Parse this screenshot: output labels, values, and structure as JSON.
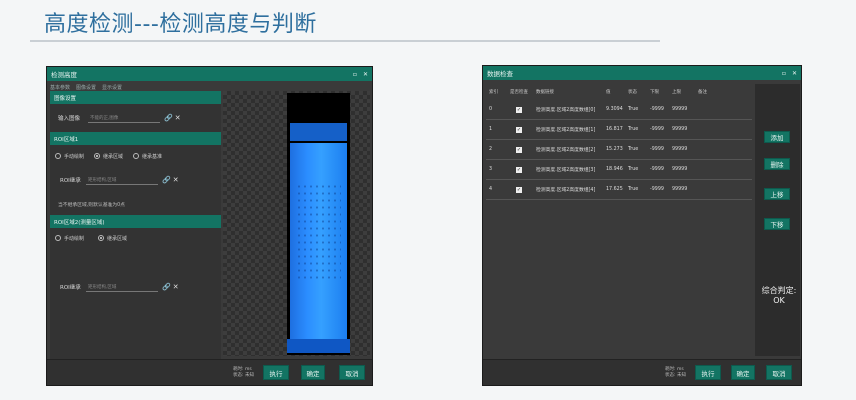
{
  "slide": {
    "title": "高度检测---检测高度与判断"
  },
  "window1": {
    "title": "检测高度",
    "tabs": [
      "基本参数",
      "图像设置",
      "显示设置"
    ],
    "section1": "图像设置",
    "input_label": "输入图像",
    "input_placeholder": "不能的正,图像",
    "section2": "ROI区域1",
    "radio1": [
      "手动绘制",
      "继承区域",
      "继承基准"
    ],
    "roi_label": "ROI继承",
    "roi_placeholder": "矩形结构,区域",
    "note": "当不继承区域,则默认基准为0点",
    "section3": "ROI区域2(测量区域)",
    "radio2": [
      "手动绘制",
      "继承区域"
    ],
    "roi2_label": "ROI继承",
    "roi2_placeholder": "矩形结构,区域",
    "status_time": "耗时: ms",
    "status_state": "状态: 未知",
    "buttons": [
      "执行",
      "确定",
      "取消"
    ]
  },
  "window2": {
    "title": "数据检查",
    "headers": [
      "索引",
      "是否检查",
      "数据链接",
      "值",
      "状态",
      "下限",
      "上限",
      "备注"
    ],
    "rows": [
      [
        "0",
        "✓",
        "检测高度.区域2高度数组[0]",
        "9.3094",
        "True",
        "-9999",
        "99999",
        ""
      ],
      [
        "1",
        "✓",
        "检测高度.区域2高度数组[1]",
        "16.817",
        "True",
        "-9999",
        "99999",
        ""
      ],
      [
        "2",
        "✓",
        "检测高度.区域2高度数组[2]",
        "15.273",
        "True",
        "-9999",
        "99999",
        ""
      ],
      [
        "3",
        "✓",
        "检测高度.区域2高度数组[3]",
        "18.946",
        "True",
        "-9999",
        "99999",
        ""
      ],
      [
        "4",
        "✓",
        "检测高度.区域2高度数组[4]",
        "17.625",
        "True",
        "-9999",
        "99999",
        ""
      ]
    ],
    "side_buttons": [
      "添加",
      "删除",
      "上移",
      "下移"
    ],
    "verdict_label": "综合判定:",
    "verdict_value": "OK",
    "status_time": "耗时: ms",
    "status_state": "状态: 未知",
    "buttons": [
      "执行",
      "确定",
      "取消"
    ]
  },
  "window_controls": {
    "min": "▫",
    "close": "✕"
  },
  "icons": {
    "link": "🔗",
    "close_x": "✕"
  }
}
